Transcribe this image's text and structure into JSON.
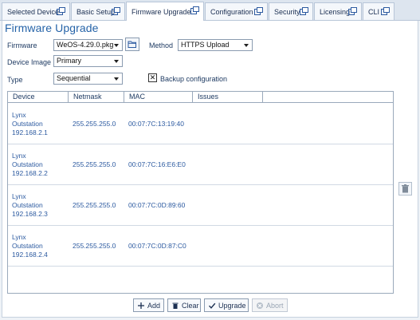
{
  "tabs": [
    {
      "label": "Selected Device",
      "active": false
    },
    {
      "label": "Basic Setup",
      "active": false
    },
    {
      "label": "Firmware Upgrade",
      "active": true
    },
    {
      "label": "Configuration",
      "active": false
    },
    {
      "label": "Security",
      "active": false
    },
    {
      "label": "Licensing",
      "active": false
    },
    {
      "label": "CLI",
      "active": false
    }
  ],
  "page": {
    "title": "Firmware Upgrade"
  },
  "form": {
    "firmware_label": "Firmware",
    "firmware_value": "WeOS-4.29.0.pkg",
    "method_label": "Method",
    "method_value": "HTTPS Upload",
    "device_image_label": "Device Image",
    "device_image_value": "Primary",
    "type_label": "Type",
    "type_value": "Sequential",
    "backup_label": "Backup configuration",
    "backup_checked": true,
    "backup_mark": "✕"
  },
  "table": {
    "headers": [
      "Device",
      "Netmask",
      "MAC",
      "Issues"
    ],
    "rows": [
      {
        "device_line1": "Lynx",
        "device_line2": "Outstation",
        "device_line3": "192.168.2.1",
        "netmask": "255.255.255.0",
        "mac": "00:07:7C:13:19:40",
        "issues": ""
      },
      {
        "device_line1": "Lynx",
        "device_line2": "Outstation",
        "device_line3": "192.168.2.2",
        "netmask": "255.255.255.0",
        "mac": "00:07:7C:16:E6:E0",
        "issues": ""
      },
      {
        "device_line1": "Lynx",
        "device_line2": "Outstation",
        "device_line3": "192.168.2.3",
        "netmask": "255.255.255.0",
        "mac": "00:07:7C:0D:89:60",
        "issues": ""
      },
      {
        "device_line1": "Lynx",
        "device_line2": "Outstation",
        "device_line3": "192.168.2.4",
        "netmask": "255.255.255.0",
        "mac": "00:07:7C:0D:87:C0",
        "issues": ""
      }
    ]
  },
  "actions": {
    "add_label": "Add",
    "clear_label": "Clear",
    "upgrade_label": "Upgrade",
    "abort_label": "Abort",
    "abort_enabled": false
  },
  "colors": {
    "accent": "#2563a8",
    "link_text": "#2c5aa0"
  }
}
